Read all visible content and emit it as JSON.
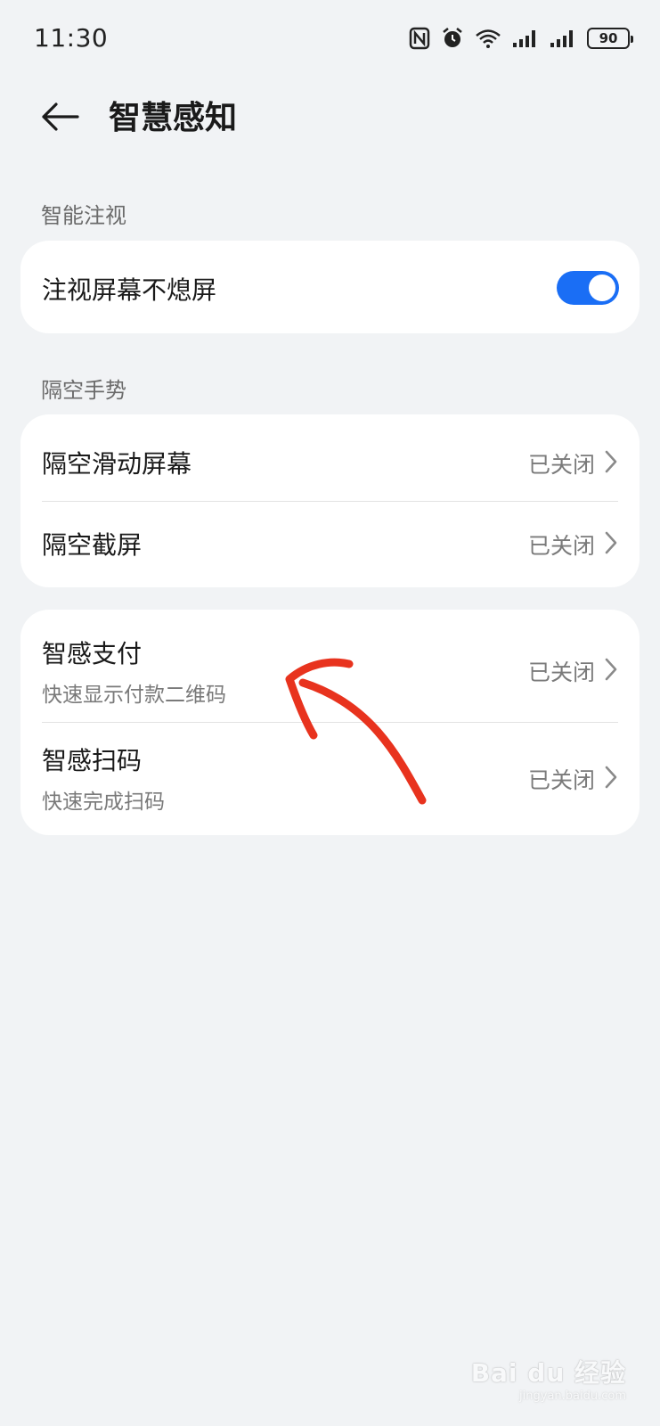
{
  "status_bar": {
    "time": "11:30",
    "battery": "90",
    "icons": [
      "nfc-icon",
      "alarm-icon",
      "wifi-icon",
      "signal-icon",
      "signal-icon",
      "battery-icon"
    ]
  },
  "header": {
    "title": "智慧感知",
    "back_icon": "back-arrow-icon"
  },
  "sections": {
    "smart_gaze": {
      "label": "智能注视",
      "items": [
        {
          "title": "注视屏幕不熄屏",
          "toggle_on": true
        }
      ]
    },
    "air_gesture": {
      "label": "隔空手势",
      "items": [
        {
          "title": "隔空滑动屏幕",
          "value": "已关闭"
        },
        {
          "title": "隔空截屏",
          "value": "已关闭"
        }
      ]
    },
    "smart_sense": {
      "items": [
        {
          "title": "智感支付",
          "subtitle": "快速显示付款二维码",
          "value": "已关闭"
        },
        {
          "title": "智感扫码",
          "subtitle": "快速完成扫码",
          "value": "已关闭"
        }
      ]
    }
  },
  "colors": {
    "background": "#f1f3f5",
    "card": "#ffffff",
    "accent": "#1a6ef5",
    "annotation": "#e8331e"
  },
  "watermark": {
    "logo": "Bai du 经验",
    "url": "jingyan.baidu.com"
  }
}
